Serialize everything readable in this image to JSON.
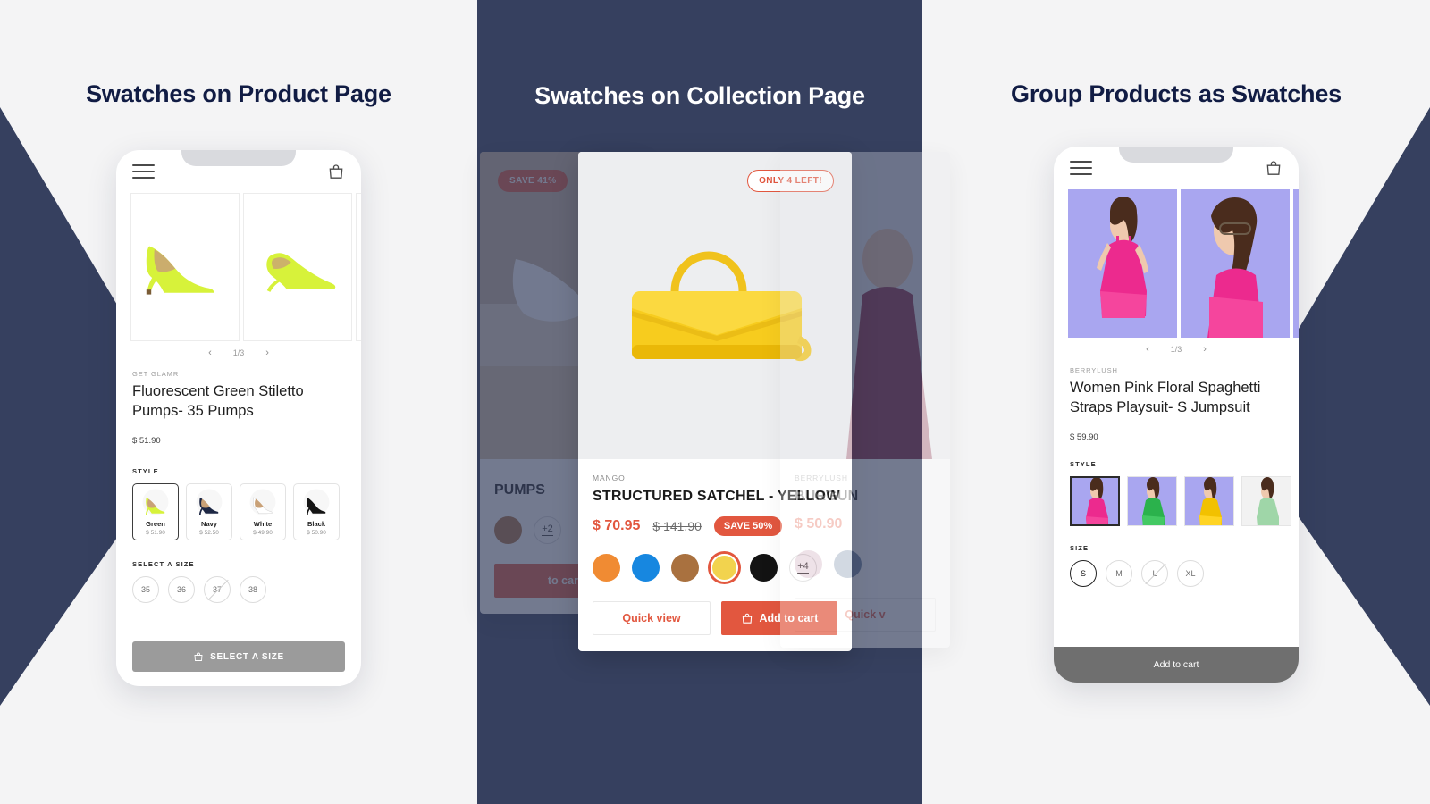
{
  "theme": {
    "navy": "#36405f",
    "page_bg": "#f4f4f5",
    "accent": "#e2573f",
    "title_navy": "#111c44"
  },
  "columns": [
    {
      "title": "Swatches on Product Page"
    },
    {
      "title": "Swatches on Collection Page"
    },
    {
      "title": "Group Products as Swatches"
    }
  ],
  "phone_product": {
    "menu_icon": "hamburger-icon",
    "cart_icon": "shopping-bag-icon",
    "gallery": {
      "counter": "1/3",
      "prev": "‹",
      "next": "›"
    },
    "vendor": "GET GLAMR",
    "title": "Fluorescent Green Stiletto Pumps- 35 Pumps",
    "price": "$ 51.90",
    "style_label": "STYLE",
    "swatches": [
      {
        "name": "Green",
        "price": "$ 51.90",
        "selected": true
      },
      {
        "name": "Navy",
        "price": "$ 52.50",
        "selected": false
      },
      {
        "name": "White",
        "price": "$ 49.90",
        "selected": false
      },
      {
        "name": "Black",
        "price": "$ 50.90",
        "selected": false
      }
    ],
    "size_label": "SELECT A SIZE",
    "sizes": [
      {
        "label": "35",
        "unavailable": false,
        "selected": false
      },
      {
        "label": "36",
        "unavailable": false,
        "selected": false
      },
      {
        "label": "37",
        "unavailable": true,
        "selected": false
      },
      {
        "label": "38",
        "unavailable": false,
        "selected": false
      }
    ],
    "cta_label": "SELECT A SIZE",
    "cta_icon": "shopping-bag-icon"
  },
  "collection": {
    "left_card": {
      "badge": "SAVE 41%",
      "title": "PUMPS",
      "more_swatches": "+2",
      "button": "to cart"
    },
    "main_card": {
      "badge": "ONLY 4 LEFT!",
      "vendor": "MANGO",
      "title": "STRUCTURED SATCHEL - YELLOW",
      "price": "$ 70.95",
      "compare_price": "$ 141.90",
      "save_badge": "SAVE 50%",
      "swatches": [
        {
          "color": "#f08b33",
          "selected": false
        },
        {
          "color": "#1787e0",
          "selected": false
        },
        {
          "color": "#a9713f",
          "selected": false
        },
        {
          "color": "#f2d34e",
          "selected": true
        },
        {
          "color": "#131313",
          "selected": false
        }
      ],
      "more_swatches": "+4",
      "quick_view_label": "Quick view",
      "add_to_cart_label": "Add to cart",
      "cart_icon": "shopping-bag-icon"
    },
    "right_card": {
      "vendor": "BERRYLUSH",
      "title": "BURGUN",
      "price": "$ 50.90",
      "swatches": [
        {
          "color": "#c9a0b4"
        },
        {
          "color": "#6e84a3"
        }
      ],
      "quick_view_label": "Quick v"
    }
  },
  "phone_group": {
    "menu_icon": "hamburger-icon",
    "cart_icon": "shopping-bag-icon",
    "gallery": {
      "counter": "1/3",
      "prev": "‹",
      "next": "›"
    },
    "vendor": "BERRYLUSH",
    "title": "Women Pink Floral Spaghetti Straps Playsuit- S Jumpsuit",
    "price": "$ 59.90",
    "style_label": "STYLE",
    "style_swatches": [
      {
        "color": "#e8338c",
        "selected": true
      },
      {
        "color": "#2bb24c",
        "selected": false
      },
      {
        "color": "#f2c100",
        "selected": false
      },
      {
        "color": "#9fd6a8",
        "selected": false
      }
    ],
    "size_label": "SIZE",
    "sizes": [
      {
        "label": "S",
        "unavailable": false,
        "selected": true
      },
      {
        "label": "M",
        "unavailable": false,
        "selected": false
      },
      {
        "label": "L",
        "unavailable": true,
        "selected": false
      },
      {
        "label": "XL",
        "unavailable": false,
        "selected": false
      }
    ],
    "cta_label": "Add to cart"
  }
}
